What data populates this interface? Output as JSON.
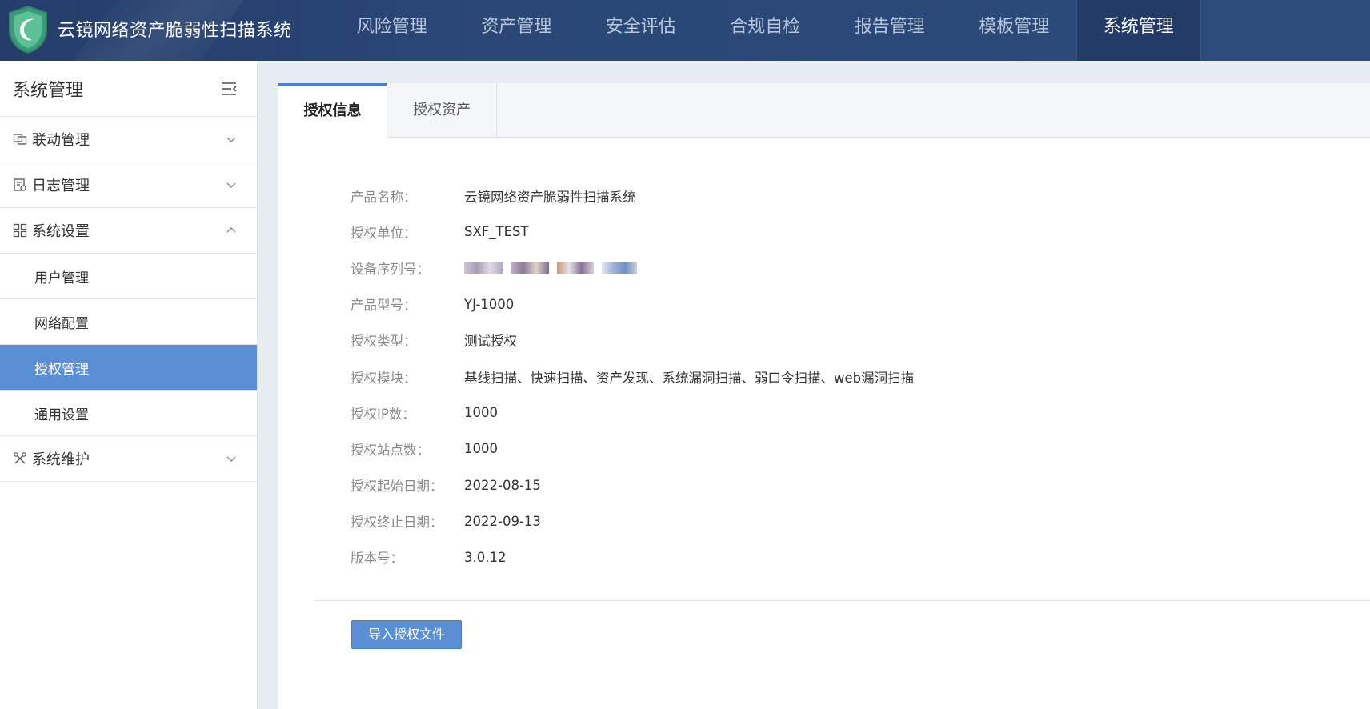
{
  "header": {
    "app_title": "云镜网络资产脆弱性扫描系统",
    "nav": [
      {
        "label": "风险管理"
      },
      {
        "label": "资产管理"
      },
      {
        "label": "安全评估"
      },
      {
        "label": "合规自检"
      },
      {
        "label": "报告管理"
      },
      {
        "label": "模板管理"
      },
      {
        "label": "系统管理",
        "active": true
      }
    ]
  },
  "sidebar": {
    "title": "系统管理",
    "groups": [
      {
        "label": "联动管理",
        "icon": "link-icon",
        "expanded": false
      },
      {
        "label": "日志管理",
        "icon": "log-icon",
        "expanded": false
      },
      {
        "label": "系统设置",
        "icon": "grid-icon",
        "expanded": true,
        "items": [
          {
            "label": "用户管理"
          },
          {
            "label": "网络配置"
          },
          {
            "label": "授权管理",
            "active": true
          },
          {
            "label": "通用设置"
          }
        ]
      },
      {
        "label": "系统维护",
        "icon": "tools-icon",
        "expanded": false
      }
    ]
  },
  "tabs": [
    {
      "label": "授权信息",
      "active": true
    },
    {
      "label": "授权资产"
    }
  ],
  "license": {
    "product_name": {
      "key": "产品名称：",
      "value": "云镜网络资产脆弱性扫描系统"
    },
    "licensee": {
      "key": "授权单位：",
      "value": "SXF_TEST"
    },
    "serial": {
      "key": "设备序列号：",
      "value": ""
    },
    "model": {
      "key": "产品型号：",
      "value": "YJ-1000"
    },
    "type": {
      "key": "授权类型：",
      "value": "测试授权"
    },
    "modules": {
      "key": "授权模块：",
      "value": "基线扫描、快速扫描、资产发现、系统漏洞扫描、弱口令扫描、web漏洞扫描"
    },
    "ip_count": {
      "key": "授权IP数：",
      "value": "1000"
    },
    "site_count": {
      "key": "授权站点数：",
      "value": "1000"
    },
    "start_date": {
      "key": "授权起始日期：",
      "value": "2022-08-15"
    },
    "end_date": {
      "key": "授权终止日期：",
      "value": "2022-09-13"
    },
    "version": {
      "key": "版本号：",
      "value": "3.0.12"
    }
  },
  "actions": {
    "import_label": "导入授权文件"
  },
  "colors": {
    "header_bg": "#2a4775",
    "accent": "#5a8fd6",
    "active_tab_border": "#4a7fd0"
  }
}
